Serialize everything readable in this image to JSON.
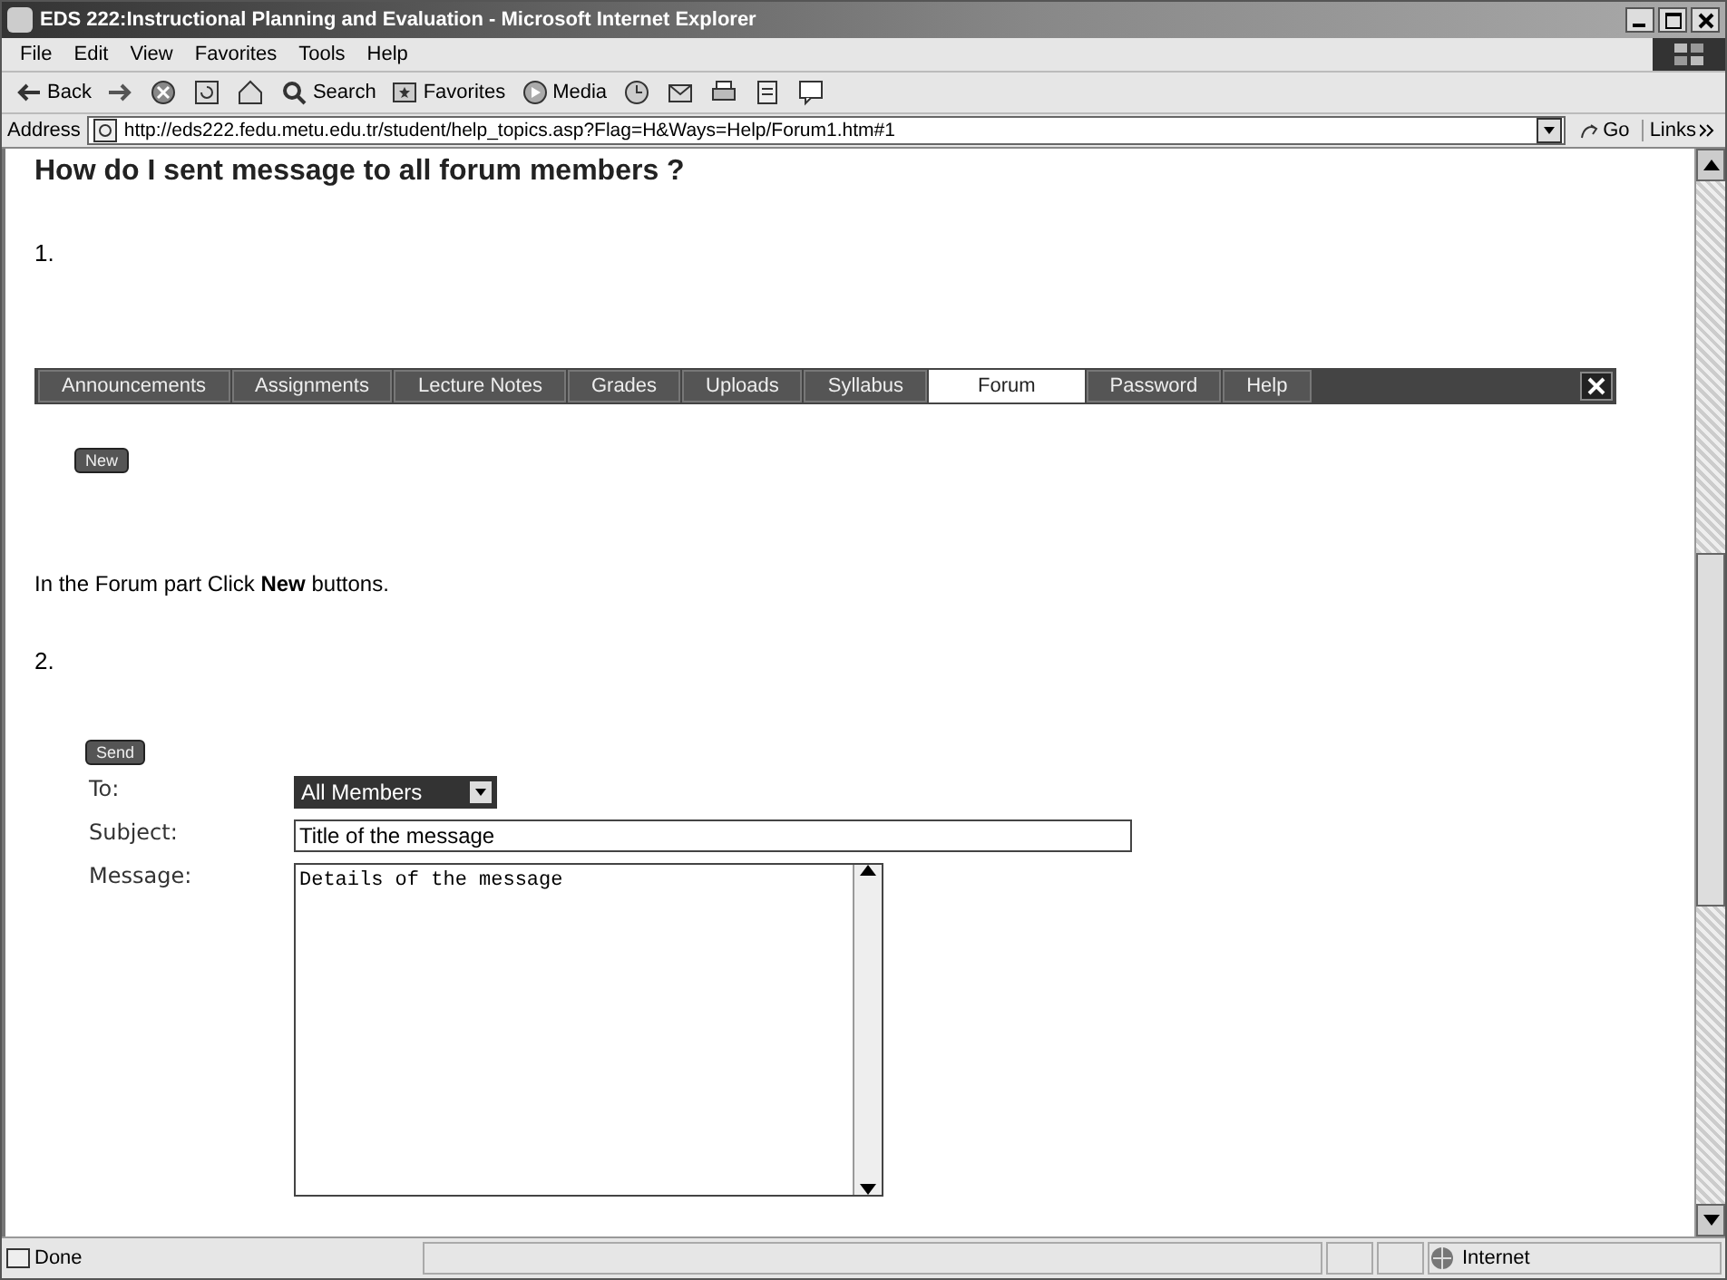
{
  "window": {
    "title": "EDS 222:Instructional Planning and Evaluation - Microsoft Internet Explorer"
  },
  "menu": [
    "File",
    "Edit",
    "View",
    "Favorites",
    "Tools",
    "Help"
  ],
  "toolbar": [
    {
      "kind": "back",
      "label": "Back"
    },
    {
      "kind": "forward"
    },
    {
      "kind": "stop"
    },
    {
      "kind": "refresh"
    },
    {
      "kind": "home"
    },
    {
      "kind": "search",
      "label": "Search"
    },
    {
      "kind": "favorites",
      "label": "Favorites"
    },
    {
      "kind": "media",
      "label": "Media"
    },
    {
      "kind": "history"
    },
    {
      "kind": "mail"
    },
    {
      "kind": "print"
    },
    {
      "kind": "edit"
    },
    {
      "kind": "discuss"
    }
  ],
  "address": {
    "label": "Address",
    "value": "http://eds222.fedu.metu.edu.tr/student/help_topics.asp?Flag=H&Ways=Help/Forum1.htm#1",
    "go": "Go",
    "links": "Links"
  },
  "heading": "How do I sent message to all forum members ?",
  "step1": "1.",
  "nav": [
    {
      "label": "Announcements",
      "selected": false
    },
    {
      "label": "Assignments",
      "selected": false
    },
    {
      "label": "Lecture Notes",
      "selected": false
    },
    {
      "label": "Grades",
      "selected": false
    },
    {
      "label": "Uploads",
      "selected": false
    },
    {
      "label": "Syllabus",
      "selected": false
    },
    {
      "label": "Forum",
      "selected": true
    },
    {
      "label": "Password",
      "selected": false
    },
    {
      "label": "Help",
      "selected": false
    }
  ],
  "new_button": "New",
  "instruction": "In the Forum part Click **New** buttons.",
  "step2": "2.",
  "send_button": "Send",
  "form": {
    "to_label": "To:",
    "to_value": "All Members",
    "subject_label": "Subject:",
    "subject_value": "Title of the message",
    "message_label": "Message:",
    "message_value": "Details of the message"
  },
  "status": {
    "text": "Done",
    "zone": "Internet"
  }
}
